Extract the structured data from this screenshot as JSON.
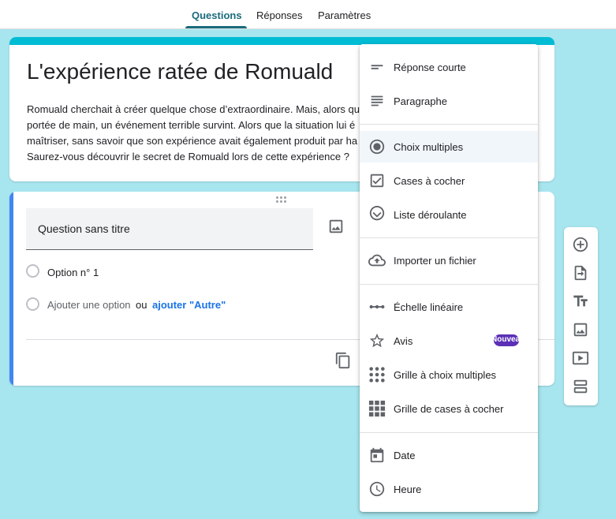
{
  "tabs": [
    {
      "label": "Questions",
      "active": true
    },
    {
      "label": "Réponses",
      "active": false
    },
    {
      "label": "Paramètres",
      "active": false
    }
  ],
  "colors": {
    "background": "#a8e6ef",
    "header_stripe": "#00bcd4",
    "active_question_bar": "#4285f4",
    "active_tab": "#1a6b7c",
    "link": "#1a73e8",
    "badge": "#5b2fb6"
  },
  "form": {
    "title": "L'expérience ratée de Romuald",
    "description": " Romuald cherchait à créer quelque chose d’extraordinaire. Mais, alors qu\nportée de main, un événement terrible survint. Alors que la situation lui é\nmaîtriser, sans savoir que son expérience avait également produit par ha\nSaurez-vous découvrir le secret de Romuald lors de cette expérience ?"
  },
  "question": {
    "title": "Question sans titre",
    "options": [
      {
        "label": "Option n° 1"
      }
    ],
    "add_option": "Ajouter une option",
    "or_text": "ou",
    "add_other": "ajouter \"Autre\""
  },
  "question_type_menu": {
    "groups": [
      [
        {
          "label": "Réponse courte",
          "icon": "short-answer-icon"
        },
        {
          "label": "Paragraphe",
          "icon": "paragraph-icon"
        }
      ],
      [
        {
          "label": "Choix multiples",
          "icon": "radio-button-icon",
          "selected": true
        },
        {
          "label": "Cases à cocher",
          "icon": "checkbox-icon"
        },
        {
          "label": "Liste déroulante",
          "icon": "dropdown-icon"
        }
      ],
      [
        {
          "label": "Importer un fichier",
          "icon": "cloud-upload-icon"
        }
      ],
      [
        {
          "label": "Échelle linéaire",
          "icon": "linear-scale-icon"
        },
        {
          "label": "Avis",
          "icon": "star-icon",
          "badge": "Nouveau"
        },
        {
          "label": "Grille à choix multiples",
          "icon": "multiple-choice-grid-icon"
        },
        {
          "label": "Grille de cases à cocher",
          "icon": "checkbox-grid-icon"
        }
      ],
      [
        {
          "label": "Date",
          "icon": "calendar-icon"
        },
        {
          "label": "Heure",
          "icon": "clock-icon"
        }
      ]
    ]
  },
  "side_toolbar": [
    {
      "icon": "add-question-icon"
    },
    {
      "icon": "import-questions-icon"
    },
    {
      "icon": "add-title-icon"
    },
    {
      "icon": "add-image-icon"
    },
    {
      "icon": "add-video-icon"
    },
    {
      "icon": "add-section-icon"
    }
  ]
}
